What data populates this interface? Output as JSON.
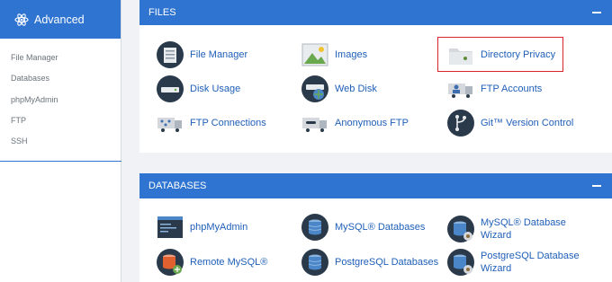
{
  "sidebar": {
    "title": "Advanced",
    "items": [
      {
        "label": "File Manager"
      },
      {
        "label": "Databases"
      },
      {
        "label": "phpMyAdmin"
      },
      {
        "label": "FTP"
      },
      {
        "label": "SSH"
      }
    ]
  },
  "files": {
    "header": "FILES",
    "items": [
      {
        "label": "File Manager",
        "icon": "file-manager-icon"
      },
      {
        "label": "Images",
        "icon": "images-icon"
      },
      {
        "label": "Directory Privacy",
        "icon": "folder-icon"
      },
      {
        "label": "Disk Usage",
        "icon": "disk-usage-icon"
      },
      {
        "label": "Web Disk",
        "icon": "web-disk-icon"
      },
      {
        "label": "FTP Accounts",
        "icon": "ftp-accounts-icon"
      },
      {
        "label": "FTP Connections",
        "icon": "ftp-connections-icon"
      },
      {
        "label": "Anonymous FTP",
        "icon": "anonymous-ftp-icon"
      },
      {
        "label": "Git™ Version Control",
        "icon": "git-icon"
      }
    ]
  },
  "databases": {
    "header": "DATABASES",
    "items": [
      {
        "label": "phpMyAdmin",
        "icon": "phpmyadmin-icon"
      },
      {
        "label": "MySQL® Databases",
        "icon": "mysql-databases-icon"
      },
      {
        "label": "MySQL® Database",
        "label2": "Wizard",
        "icon": "mysql-wizard-icon"
      },
      {
        "label": "Remote MySQL®",
        "icon": "remote-mysql-icon"
      },
      {
        "label": "PostgreSQL Databases",
        "icon": "postgresql-databases-icon"
      },
      {
        "label": "PostgreSQL Database",
        "label2": "Wizard",
        "icon": "postgresql-wizard-icon"
      }
    ]
  },
  "colors": {
    "accent": "#2f74d0",
    "link": "#1f5fb8",
    "highlight": "#d9232d"
  }
}
